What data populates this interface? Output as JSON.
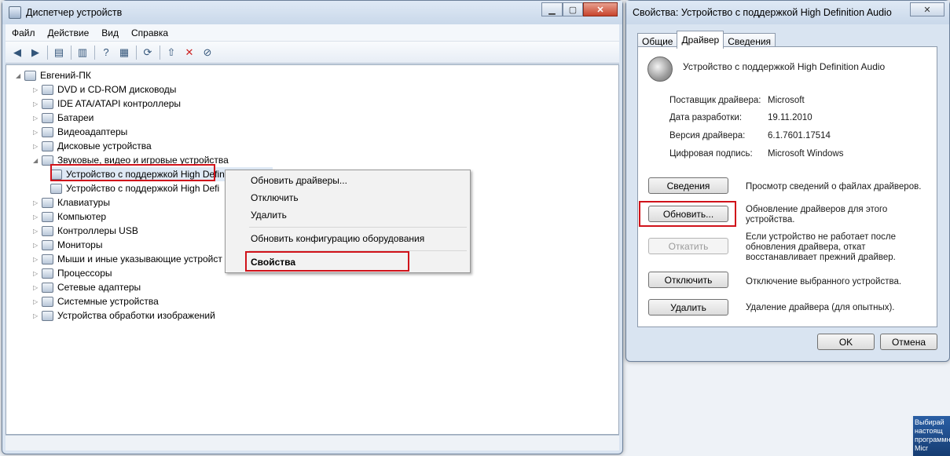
{
  "device_manager": {
    "title": "Диспетчер устройств",
    "menu": [
      "Файл",
      "Действие",
      "Вид",
      "Справка"
    ],
    "tree": {
      "root": "Евгений-ПК",
      "items": [
        "DVD и CD-ROM дисководы",
        "IDE ATA/ATAPI контроллеры",
        "Батареи",
        "Видеоадаптеры",
        "Дисковые устройства",
        "Звуковые, видео и игровые устройства",
        "Устройство с поддержкой High Definition Audio",
        "Устройство с поддержкой High Defi",
        "Клавиатуры",
        "Компьютер",
        "Контроллеры USB",
        "Мониторы",
        "Мыши и иные указывающие устройст",
        "Процессоры",
        "Сетевые адаптеры",
        "Системные устройства",
        "Устройства обработки изображений"
      ]
    },
    "context_menu": {
      "update": "Обновить драйверы...",
      "disable": "Отключить",
      "delete": "Удалить",
      "scan": "Обновить конфигурацию оборудования",
      "properties": "Свойства"
    }
  },
  "properties": {
    "title": "Свойства: Устройство с поддержкой High Definition Audio",
    "tabs": [
      "Общие",
      "Драйвер",
      "Сведения"
    ],
    "device_name": "Устройство с поддержкой High Definition Audio",
    "fields": [
      {
        "label": "Поставщик драйвера:",
        "value": "Microsoft"
      },
      {
        "label": "Дата разработки:",
        "value": "19.11.2010"
      },
      {
        "label": "Версия драйвера:",
        "value": "6.1.7601.17514"
      },
      {
        "label": "Цифровая подпись:",
        "value": "Microsoft Windows"
      }
    ],
    "buttons": {
      "details": {
        "label": "Сведения",
        "desc": "Просмотр сведений о файлах драйверов."
      },
      "update": {
        "label": "Обновить...",
        "desc": "Обновление драйверов для этого устройства."
      },
      "rollback": {
        "label": "Откатить",
        "desc": "Если устройство не работает после обновления драйвера, откат восстанавливает прежний драйвер."
      },
      "disable": {
        "label": "Отключить",
        "desc": "Отключение выбранного устройства."
      },
      "uninstall": {
        "label": "Удалить",
        "desc": "Удаление драйвера (для опытных)."
      }
    },
    "ok": "OK",
    "cancel": "Отмена"
  },
  "taskbar_ad": "Выбирай настоящ программное Micr",
  "colors": {
    "highlight": "#d0121a",
    "title_bg": "#c9d8ea"
  }
}
